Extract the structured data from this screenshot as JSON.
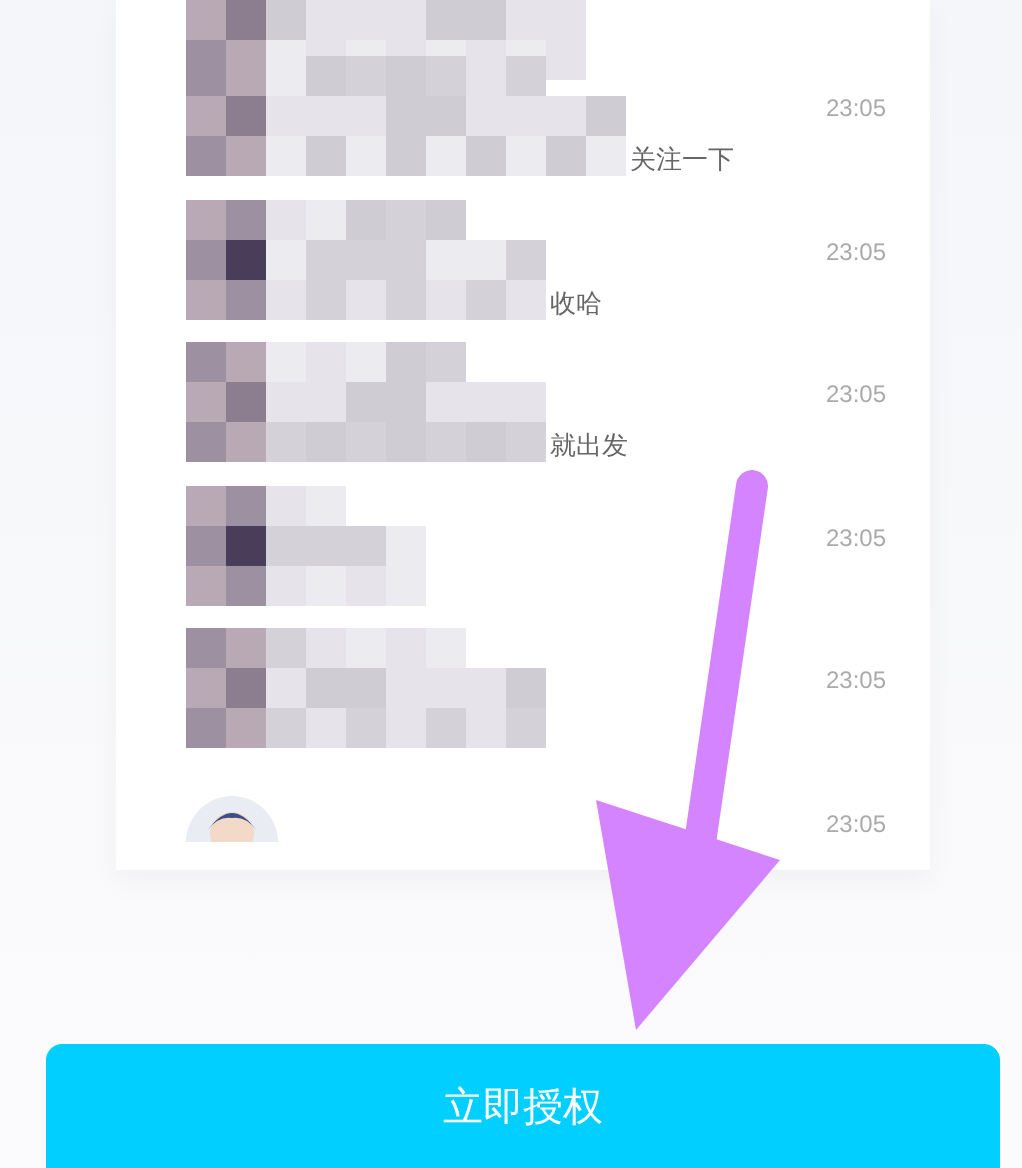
{
  "messages": [
    {
      "kind": "blurred",
      "time": "23:05",
      "text": "关注一下"
    },
    {
      "kind": "blurred",
      "time": "23:05",
      "text": "收哈"
    },
    {
      "kind": "blurred",
      "time": "23:05",
      "text": "就出发"
    },
    {
      "kind": "blurred",
      "time": "23:05"
    },
    {
      "kind": "blurred",
      "time": "23:05"
    },
    {
      "kind": "avatar",
      "time": "23:05"
    }
  ],
  "button": {
    "label": "立即授权"
  }
}
